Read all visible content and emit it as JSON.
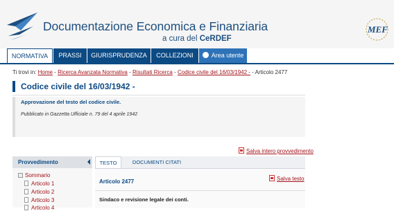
{
  "header": {
    "title": "Documentazione Economica e Finanziaria",
    "subtitle_prefix": "a cura del ",
    "subtitle_brand": "CeRDEF",
    "logo_text": "MEF",
    "colors": {
      "brand_blue": "#0c4a84",
      "accent_blue": "#2e73b8",
      "link_red": "#a3121a"
    }
  },
  "nav": {
    "tabs": [
      {
        "label": "NORMATIVA",
        "active": true
      },
      {
        "label": "PRASSI",
        "active": false
      },
      {
        "label": "GIURISPRUDENZA",
        "active": false
      },
      {
        "label": "COLLEZIONI",
        "active": false
      },
      {
        "label": "Area utente",
        "active": false,
        "icon": "user-icon"
      }
    ]
  },
  "breadcrumb": {
    "prefix": "Ti trovi in:",
    "items": [
      "Home",
      "Ricerca Avanzata Normativa",
      "Risultati Ricerca",
      "Codice civile del 16/03/1942 -"
    ],
    "current": "Articolo 2477",
    "separator": "-"
  },
  "document": {
    "title": "Codice civile del 16/03/1942 -",
    "approval": "Approvazione del testo del codice civile.",
    "publication": "Pubblicato in Gazzetta Ufficiale n. 79 del 4 aprile 1942",
    "save_full": "Salva intero provvedimento"
  },
  "sidebar": {
    "title": "Provvedimento",
    "root": "Sommario",
    "items": [
      "Articolo 1",
      "Articolo 2",
      "Articolo 3",
      "Articolo 4"
    ]
  },
  "content_tabs": [
    {
      "label": "TESTO",
      "active": true
    },
    {
      "label": "DOCUMENTI CITATI",
      "active": false
    }
  ],
  "article": {
    "title": "Articolo 2477",
    "save_label": "Salva testo",
    "heading": "Sindaco e revisione legale dei conti."
  }
}
